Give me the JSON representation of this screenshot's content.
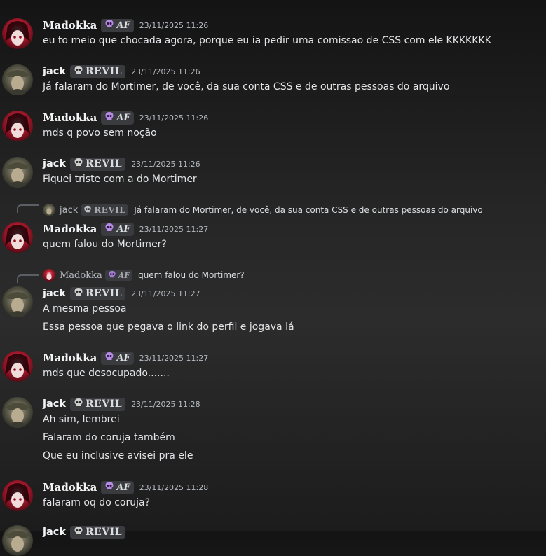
{
  "users": {
    "madokka": {
      "name": "Madokka",
      "tag": "AF",
      "tag_display": "AF"
    },
    "jack": {
      "name": "jack",
      "tag": "REVIL"
    }
  },
  "colors": {
    "madokka_avatar": "#a3162a",
    "jack_avatar": "#5a5a4a",
    "tag_bg": "#3a3b3f",
    "timestamp": "#b5bac1"
  },
  "messages": [
    {
      "author": "Madokka",
      "tag": "AF",
      "timestamp": "23/11/2025 11:26",
      "lines": [
        "eu to meio que chocada agora, porque eu ia pedir uma comissao de CSS com ele KKKKKKK"
      ]
    },
    {
      "author": "jack",
      "tag": "REVIL",
      "timestamp": "23/11/2025 11:26",
      "lines": [
        "Já falaram do Mortimer, de você, da sua conta CSS e de outras pessoas do arquivo"
      ]
    },
    {
      "author": "Madokka",
      "tag": "AF",
      "timestamp": "23/11/2025 11:26",
      "lines": [
        "mds q povo sem noção"
      ]
    },
    {
      "author": "jack",
      "tag": "REVIL",
      "timestamp": "23/11/2025 11:26",
      "lines": [
        "Fiquei triste com a do Mortimer"
      ]
    },
    {
      "author": "Madokka",
      "tag": "AF",
      "timestamp": "23/11/2025 11:27",
      "reply": {
        "author": "jack",
        "tag": "REVIL",
        "text": "Já falaram do Mortimer, de você, da sua conta CSS e de outras pessoas do arquivo"
      },
      "lines": [
        "quem falou do Mortimer?"
      ]
    },
    {
      "author": "jack",
      "tag": "REVIL",
      "timestamp": "23/11/2025 11:27",
      "reply": {
        "author": "Madokka",
        "tag": "AF",
        "text": "quem falou do Mortimer?"
      },
      "lines": [
        "A mesma pessoa",
        "Essa pessoa que pegava o link do perfil e jogava lá"
      ]
    },
    {
      "author": "Madokka",
      "tag": "AF",
      "timestamp": "23/11/2025 11:27",
      "lines": [
        "mds que desocupado......."
      ]
    },
    {
      "author": "jack",
      "tag": "REVIL",
      "timestamp": "23/11/2025 11:28",
      "lines": [
        "Ah sim, lembrei",
        "Falaram do coruja também",
        "Que eu inclusive avisei pra ele"
      ]
    },
    {
      "author": "Madokka",
      "tag": "AF",
      "timestamp": "23/11/2025 11:28",
      "lines": [
        "falaram oq do coruja?"
      ]
    },
    {
      "author": "jack",
      "tag": "REVIL",
      "timestamp": "",
      "lines": []
    }
  ]
}
